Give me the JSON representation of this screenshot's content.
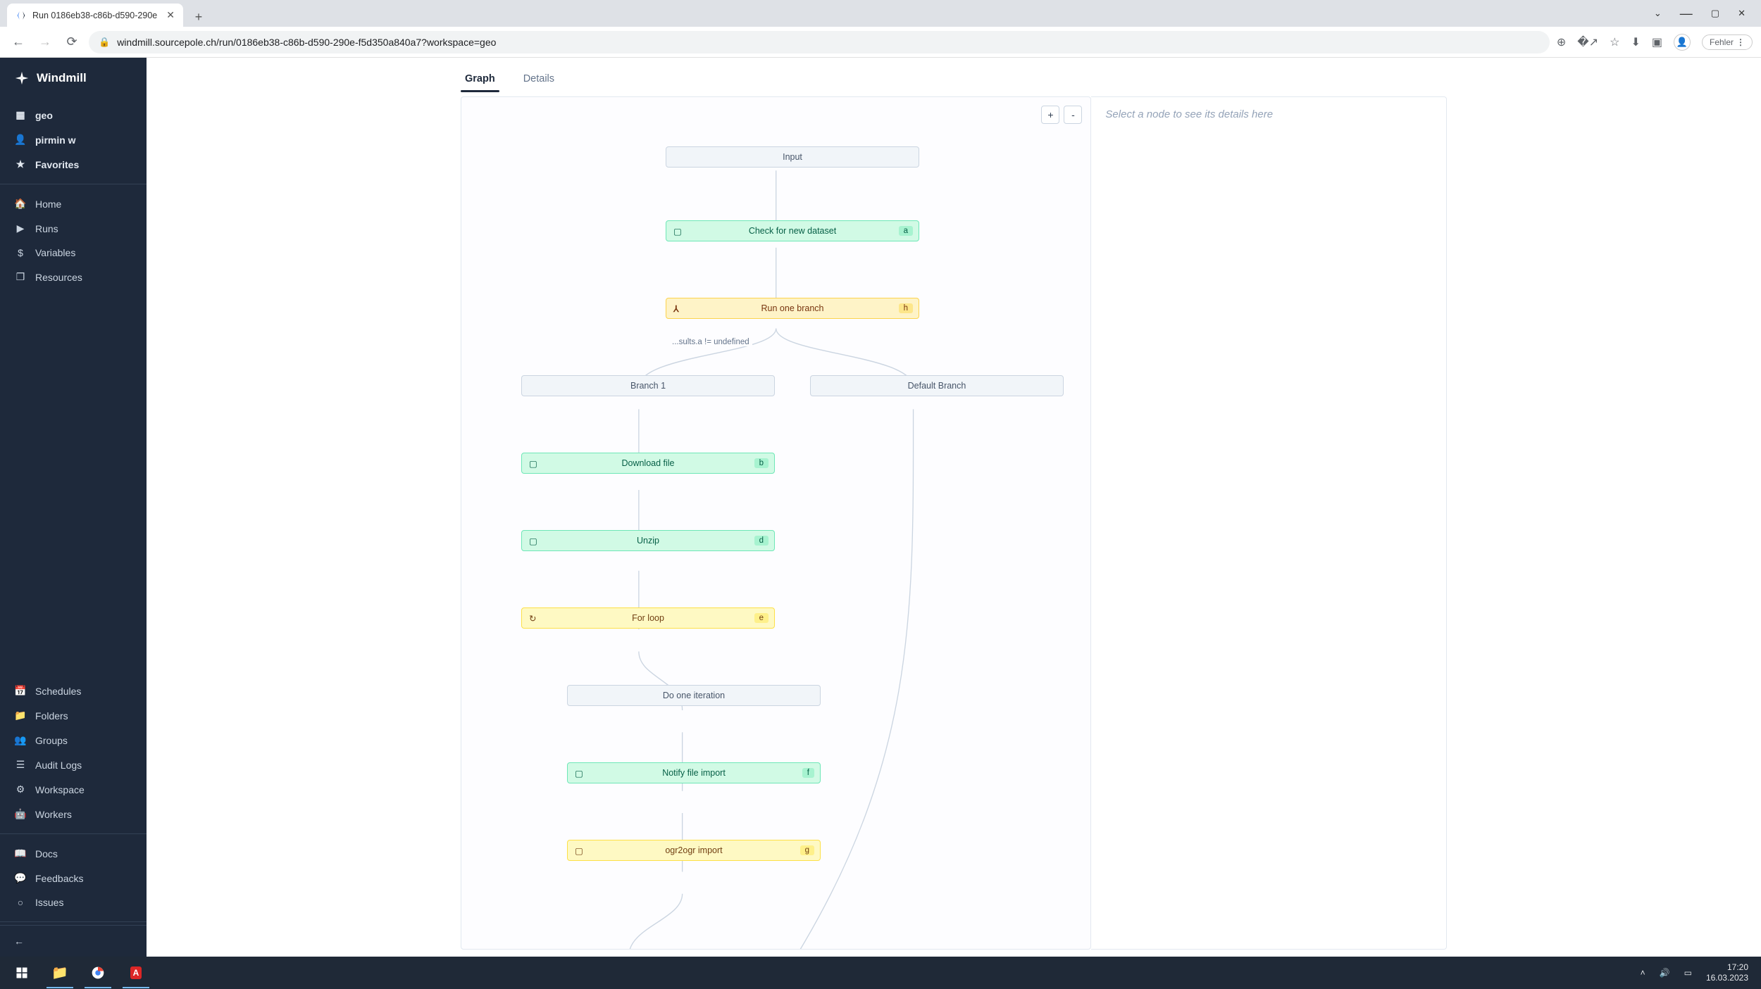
{
  "browser": {
    "tab_title": "Run 0186eb38-c86b-d590-290e",
    "url": "windmill.sourcepole.ch/run/0186eb38-c86b-d590-290e-f5d350a840a7?workspace=geo",
    "fehler": "Fehler"
  },
  "sidebar": {
    "logo": "Windmill",
    "workspace": "geo",
    "user": "pirmin w",
    "favorites": "Favorites",
    "nav": [
      {
        "icon": "home",
        "label": "Home"
      },
      {
        "icon": "play",
        "label": "Runs"
      },
      {
        "icon": "dollar",
        "label": "Variables"
      },
      {
        "icon": "cube",
        "label": "Resources"
      }
    ],
    "admin": [
      {
        "icon": "calendar",
        "label": "Schedules"
      },
      {
        "icon": "folder",
        "label": "Folders"
      },
      {
        "icon": "users",
        "label": "Groups"
      },
      {
        "icon": "list",
        "label": "Audit Logs"
      },
      {
        "icon": "gear",
        "label": "Workspace"
      },
      {
        "icon": "robot",
        "label": "Workers"
      }
    ],
    "help": [
      {
        "icon": "book",
        "label": "Docs"
      },
      {
        "icon": "discord",
        "label": "Feedbacks"
      },
      {
        "icon": "github",
        "label": "Issues"
      }
    ]
  },
  "tabs": {
    "graph": "Graph",
    "details": "Details"
  },
  "detail_placeholder": "Select a node to see its details here",
  "zoom": {
    "plus": "+",
    "minus": "-"
  },
  "graph": {
    "edge_label": "...sults.a != undefined",
    "nodes": {
      "input": {
        "label": "Input"
      },
      "check": {
        "label": "Check for new dataset",
        "badge": "a"
      },
      "runone": {
        "label": "Run one branch",
        "badge": "h"
      },
      "branch1": {
        "label": "Branch 1"
      },
      "default_branch": {
        "label": "Default Branch"
      },
      "download": {
        "label": "Download file",
        "badge": "b"
      },
      "unzip": {
        "label": "Unzip",
        "badge": "d"
      },
      "forloop": {
        "label": "For loop",
        "badge": "e"
      },
      "doone": {
        "label": "Do one iteration"
      },
      "notify": {
        "label": "Notify file import",
        "badge": "f"
      },
      "ogr": {
        "label": "ogr2ogr import",
        "badge": "g"
      }
    }
  },
  "taskbar": {
    "time": "17:20",
    "date": "16.03.2023"
  }
}
